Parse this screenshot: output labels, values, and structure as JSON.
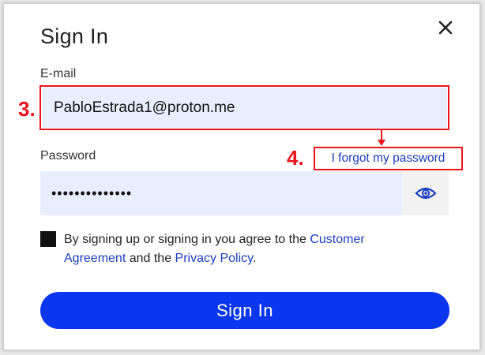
{
  "dialog": {
    "title": "Sign In"
  },
  "email": {
    "label": "E-mail",
    "value": "PabloEstrada1@proton.me"
  },
  "password": {
    "label": "Password",
    "value": "••••••••••••••",
    "forgot_link": "I forgot my password"
  },
  "annotations": {
    "step3": "3.",
    "step4": "4."
  },
  "consent": {
    "text_before": "By signing up or signing in you agree to the ",
    "link1": "Customer Agreement",
    "text_middle": " and the ",
    "link2": "Privacy Policy",
    "text_after": "."
  },
  "submit": {
    "label": "Sign In"
  },
  "icons": {
    "close": "close-icon",
    "eye": "eye-icon"
  },
  "colors": {
    "accent": "#0a36ee",
    "link": "#1b3fbf",
    "annotation": "#e8151b",
    "input_bg": "#e8eefe"
  }
}
